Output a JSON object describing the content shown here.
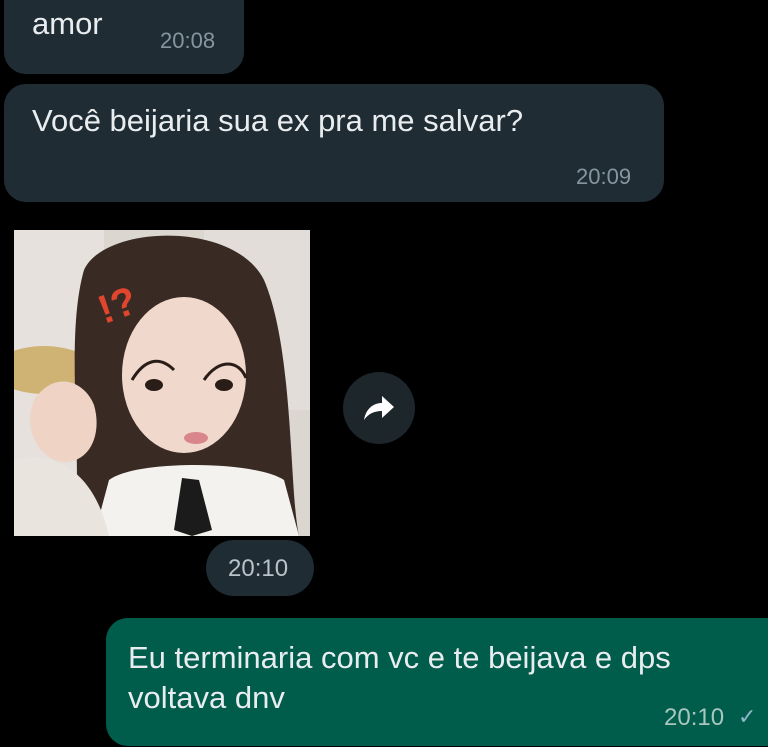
{
  "messages": [
    {
      "direction": "incoming",
      "text": "amor",
      "time": "20:08"
    },
    {
      "direction": "incoming",
      "text": "Você beijaria sua ex pra me salvar?",
      "time": "20:09"
    },
    {
      "direction": "incoming",
      "type": "image",
      "time": "20:10",
      "forward_icon": "forward-arrow-icon"
    },
    {
      "direction": "outgoing",
      "text": "Eu terminaria com vc e te beijava e dps voltava dnv",
      "time": "20:10",
      "status_icon": "sent-check-icon"
    }
  ],
  "colors": {
    "background": "#000000",
    "incoming_bubble": "#1f2c34",
    "outgoing_bubble": "#005c4b",
    "timestamp": "#8696a0"
  }
}
